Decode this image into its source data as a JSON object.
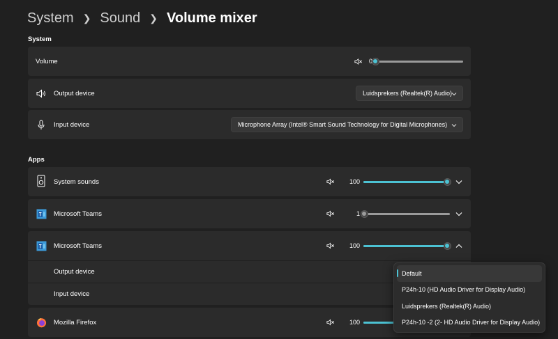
{
  "breadcrumb": {
    "items": [
      "System",
      "Sound"
    ],
    "current": "Volume mixer"
  },
  "system": {
    "section_label": "System",
    "volume": {
      "label": "Volume",
      "value": "0",
      "level": 0
    },
    "output_device": {
      "label": "Output device",
      "selected": "Luidsprekers (Realtek(R) Audio)"
    },
    "input_device": {
      "label": "Input device",
      "selected": "Microphone Array (Intel® Smart Sound Technology for Digital Microphones)"
    }
  },
  "apps": {
    "section_label": "Apps",
    "items": [
      {
        "label": "System sounds",
        "value": "100",
        "level": 100,
        "icon": "speaker-icon"
      },
      {
        "label": "Microsoft Teams",
        "value": "1",
        "level": 1,
        "icon": "teams-icon"
      },
      {
        "label": "Microsoft Teams",
        "value": "100",
        "level": 100,
        "icon": "teams-icon"
      },
      {
        "label": "Mozilla Firefox",
        "value": "100",
        "level": 100,
        "icon": "firefox-icon"
      }
    ],
    "expanded": {
      "output_label": "Output device",
      "input_label": "Input device"
    }
  },
  "output_popup": {
    "options": [
      "Default",
      "P24h-10 (HD Audio Driver for Display Audio)",
      "Luidsprekers (Realtek(R) Audio)",
      "P24h-10 -2 (2- HD Audio Driver for Display Audio)"
    ],
    "selected_index": 0
  },
  "colors": {
    "accent": "#4cc2d3",
    "background": "#202020",
    "card": "#2b2b2b"
  }
}
